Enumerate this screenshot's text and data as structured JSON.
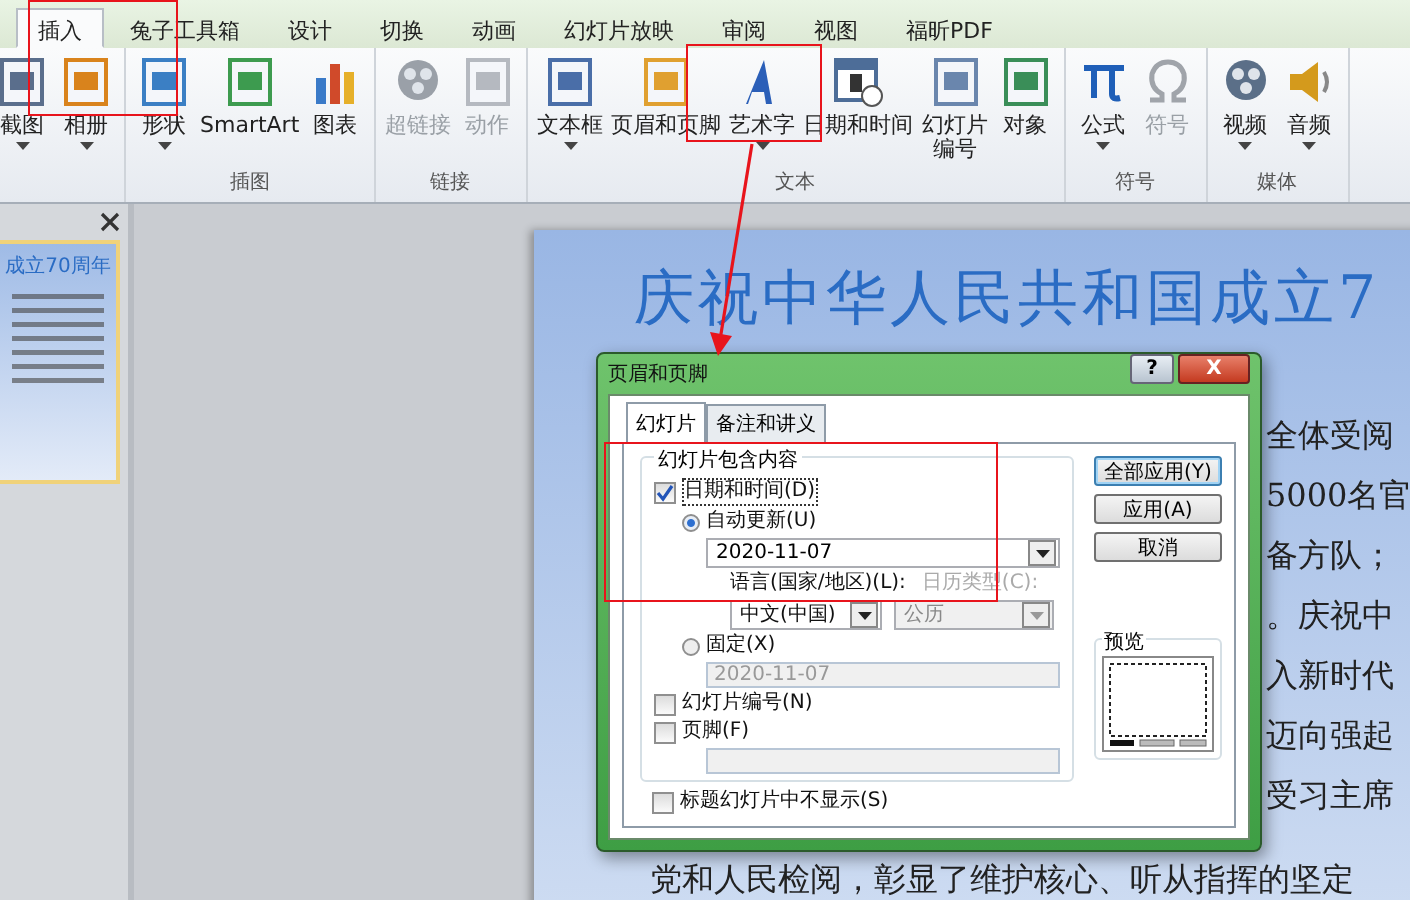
{
  "ribbon_tabs": [
    {
      "label": "插入",
      "selected": true
    },
    {
      "label": "兔子工具箱",
      "selected": false
    },
    {
      "label": "设计",
      "selected": false
    },
    {
      "label": "切换",
      "selected": false
    },
    {
      "label": "动画",
      "selected": false
    },
    {
      "label": "幻灯片放映",
      "selected": false
    },
    {
      "label": "审阅",
      "selected": false
    },
    {
      "label": "视图",
      "selected": false
    },
    {
      "label": "福昕PDF",
      "selected": false
    }
  ],
  "ribbon_groups": [
    {
      "items": [
        {
          "label": "截图",
          "disabled": false,
          "dropdown": true
        },
        {
          "label": "相册",
          "disabled": false,
          "dropdown": true
        }
      ]
    },
    {
      "label": "插图",
      "items": [
        {
          "label": "形状",
          "disabled": false,
          "dropdown": true
        },
        {
          "label": "SmartArt",
          "disabled": false,
          "dropdown": false
        },
        {
          "label": "图表",
          "disabled": false,
          "dropdown": false
        }
      ]
    },
    {
      "label": "链接",
      "items": [
        {
          "label": "超链接",
          "disabled": true,
          "dropdown": false
        },
        {
          "label": "动作",
          "disabled": true,
          "dropdown": false
        }
      ]
    },
    {
      "label": "文本",
      "items": [
        {
          "label": "文本框",
          "disabled": false,
          "dropdown": true
        },
        {
          "label": "页眉和页脚",
          "disabled": false,
          "dropdown": false
        },
        {
          "label": "艺术字",
          "disabled": false,
          "dropdown": true
        },
        {
          "label": "日期和时间",
          "disabled": false,
          "dropdown": false
        },
        {
          "label": "幻灯片编号",
          "disabled": false,
          "dropdown": false,
          "wrapped": true
        },
        {
          "label": "对象",
          "disabled": false,
          "dropdown": false
        }
      ]
    },
    {
      "label": "符号",
      "items": [
        {
          "label": "公式",
          "disabled": false,
          "dropdown": true
        },
        {
          "label": "符号",
          "disabled": true,
          "dropdown": false
        }
      ]
    },
    {
      "label": "媒体",
      "items": [
        {
          "label": "视频",
          "disabled": false,
          "dropdown": true
        },
        {
          "label": "音频",
          "disabled": false,
          "dropdown": true
        }
      ]
    }
  ],
  "thumbnail": {
    "title": "成立70周年"
  },
  "slide": {
    "title": "庆祝中华人民共和国成立7",
    "lines": [
      "全体受阅",
      "5000名官",
      "备方队；",
      "。庆祝中",
      "入新时代",
      "迈向强起",
      "受习主席"
    ],
    "bottom_line": "党和人民检阅，彰显了维护核心、听从指挥的坚定"
  },
  "dialog": {
    "title": "页眉和页脚",
    "help": "?",
    "close": "X",
    "tabs": [
      {
        "label": "幻灯片",
        "selected": true
      },
      {
        "label": "备注和讲义",
        "selected": false
      }
    ],
    "group_title": "幻灯片包含内容",
    "date_time": {
      "label": "日期和时间(D)",
      "checked": true
    },
    "auto_update": {
      "label": "自动更新(U)",
      "selected": true,
      "value": "2020-11-07"
    },
    "language_label": "语言(国家/地区)(L):",
    "calendar_label": "日历类型(C):",
    "language_value": "中文(中国)",
    "calendar_value": "公历",
    "fixed": {
      "label": "固定(X)",
      "selected": false,
      "value": "2020-11-07"
    },
    "slide_number": {
      "label": "幻灯片编号(N)",
      "checked": false
    },
    "footer": {
      "label": "页脚(F)",
      "checked": false
    },
    "hide_on_title": {
      "label": "标题幻灯片中不显示(S)",
      "checked": false
    },
    "buttons": [
      "全部应用(Y)",
      "应用(A)",
      "取消"
    ],
    "preview_label": "预览"
  }
}
